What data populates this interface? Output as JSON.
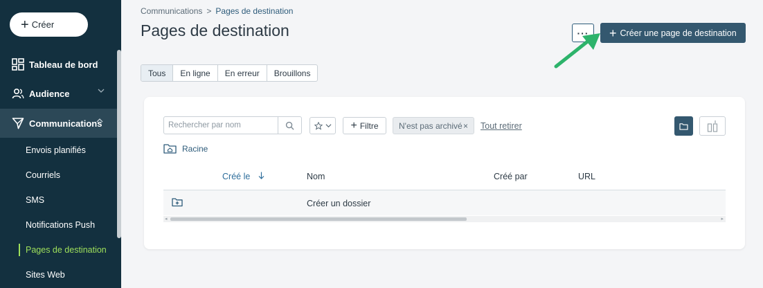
{
  "sidebar": {
    "create_label": "Créer",
    "items": [
      {
        "label": "Tableau de bord",
        "icon": "dashboard-icon"
      },
      {
        "label": "Audience",
        "icon": "audience-icon"
      },
      {
        "label": "Communications",
        "icon": "send-icon"
      }
    ],
    "sub_items": [
      {
        "label": "Envois planifiés"
      },
      {
        "label": "Courriels"
      },
      {
        "label": "SMS"
      },
      {
        "label": "Notifications Push"
      },
      {
        "label": "Pages de destination"
      },
      {
        "label": "Sites Web"
      }
    ],
    "current_sub_item": "Pages de destination"
  },
  "breadcrumb": {
    "parent": "Communications",
    "separator": ">",
    "current": "Pages de destination"
  },
  "page_title": "Pages de destination",
  "toolbar": {
    "more_label": "···",
    "primary_label": "Créer une page de destination"
  },
  "tabs": [
    {
      "label": "Tous",
      "selected": true
    },
    {
      "label": "En ligne",
      "selected": false
    },
    {
      "label": "En erreur",
      "selected": false
    },
    {
      "label": "Brouillons",
      "selected": false
    }
  ],
  "filters": {
    "search_placeholder": "Rechercher par nom",
    "filter_label": "Filtre",
    "chip_label": "N'est pas archivé",
    "clear_all_label": "Tout retirer"
  },
  "folder": {
    "root_label": "Racine"
  },
  "table": {
    "columns": [
      {
        "label": "Créé le",
        "sort": "desc"
      },
      {
        "label": "Nom"
      },
      {
        "label": "Créé par"
      },
      {
        "label": "URL"
      }
    ],
    "rows": [
      {
        "name": "Créer un dossier",
        "icon": "add-folder-icon"
      }
    ]
  },
  "colors": {
    "sidebar_bg": "#13303f",
    "sidebar_active_bg": "#2c4857",
    "accent_green": "#9fe05b",
    "primary_button": "#34586f",
    "annotation_arrow": "#2db36b"
  }
}
